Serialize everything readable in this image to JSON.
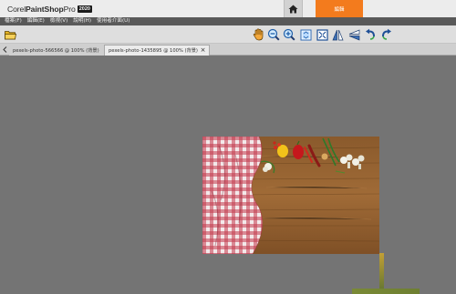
{
  "titlebar": {
    "logo_brand": "Corel",
    "logo_product": "PaintShop",
    "logo_suffix": "Pro",
    "logo_year": "2020",
    "edit_tab_label": "編輯"
  },
  "menu": {
    "items": [
      "檔案(F)",
      "編輯(E)",
      "檢視(V)",
      "說明(H)",
      "使用者介面(U)"
    ]
  },
  "toolbar": {
    "tools": [
      "folder-icon",
      "pan-hand-icon",
      "zoom-out-icon",
      "zoom-in-icon",
      "actual-size-icon",
      "fit-window-icon",
      "flip-horizontal-icon",
      "flip-vertical-icon",
      "rotate-left-icon",
      "rotate-right-icon"
    ]
  },
  "tabs": {
    "items": [
      {
        "label": "pexels-photo-566566 @ 100% (背景)",
        "active": false
      },
      {
        "label": "pexels-photo-1435895 @ 100% (背景)",
        "active": true
      }
    ],
    "close_symbol": "×"
  },
  "colors": {
    "accent": "#f37b1d",
    "menubar": "#595959",
    "canvas": "#747474",
    "toolbar": "#dedede"
  }
}
